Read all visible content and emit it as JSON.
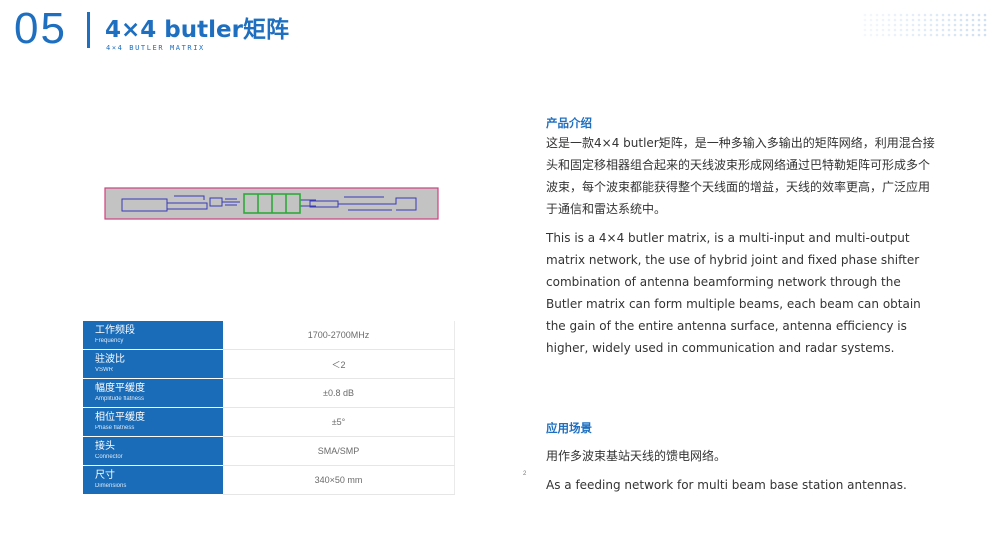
{
  "header": {
    "number": "05",
    "title": "4×4 butler矩阵",
    "subtitle": "4×4 BUTLER MATRIX"
  },
  "colors": {
    "accent": "#1e6fc0",
    "table_label_bg": "#1a6cb8"
  },
  "specs": [
    {
      "label_zh": "工作频段",
      "label_en": "Frequency",
      "value": "1700-2700MHz"
    },
    {
      "label_zh": "驻波比",
      "label_en": "VSWR",
      "value": "＜2"
    },
    {
      "label_zh": "幅度平缓度",
      "label_en": "Amplitude flatness",
      "value": "±0.8 dB"
    },
    {
      "label_zh": "相位平缓度",
      "label_en": "Phase flatness",
      "value": "±5°"
    },
    {
      "label_zh": "接头",
      "label_en": "Connector",
      "value": "SMA/SMP"
    },
    {
      "label_zh": "尺寸",
      "label_en": "Dimensions",
      "value": "340×50 mm",
      "superscript": "2"
    }
  ],
  "intro": {
    "title": "产品介绍",
    "zh": "这是一款4×4 butler矩阵，是一种多输入多输出的矩阵网络，利用混合接头和固定移相器组合起来的天线波束形成网络通过巴特勒矩阵可形成多个波束，每个波束都能获得整个天线面的增益，天线的效率更高，广泛应用于通信和雷达系统中。",
    "en": "This is a 4×4 butler matrix, is a multi-input and multi-output matrix network, the use of hybrid joint and fixed phase shifter combination of antenna beamforming network through the Butler matrix can form multiple beams, each beam can obtain the gain of the entire antenna surface, antenna efficiency is higher, widely used in communication and radar systems."
  },
  "application": {
    "title": "应用场景",
    "zh": "用作多波束基站天线的馈电网络。",
    "en": "As a feeding network for multi beam base station antennas."
  }
}
